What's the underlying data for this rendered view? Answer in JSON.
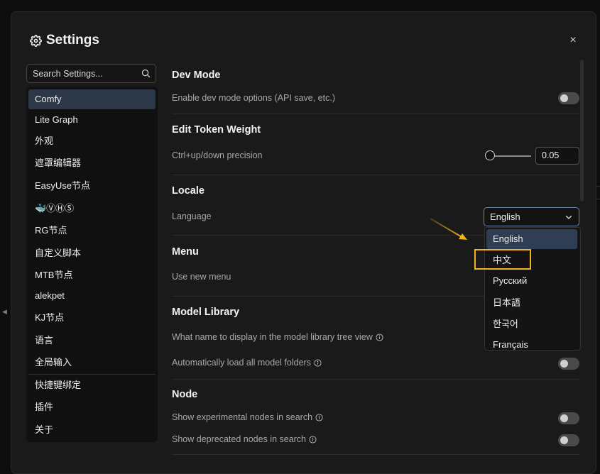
{
  "dialog": {
    "title": "Settings",
    "close_label": "×"
  },
  "search": {
    "placeholder": "Search Settings..."
  },
  "sidebar": {
    "items": [
      {
        "label": "Comfy",
        "active": true
      },
      {
        "label": "Lite Graph"
      },
      {
        "label": "外观"
      },
      {
        "label": "遮罩编辑器"
      },
      {
        "label": "EasyUse节点"
      },
      {
        "label": "🐳ⓋⒽⓈ"
      },
      {
        "label": "RG节点"
      },
      {
        "label": "自定义脚本"
      },
      {
        "label": "MTB节点"
      },
      {
        "label": "alekpet"
      },
      {
        "label": "KJ节点"
      },
      {
        "label": "语言"
      },
      {
        "label": "全局输入"
      },
      {
        "label": "快捷键绑定"
      },
      {
        "label": "插件"
      },
      {
        "label": "关于"
      }
    ]
  },
  "sections": {
    "dev_mode": {
      "title": "Dev Mode",
      "enable_label": "Enable dev mode options (API save, etc.)"
    },
    "edit_token_weight": {
      "title": "Edit Token Weight",
      "precision_label": "Ctrl+up/down precision",
      "precision_value": "0.05"
    },
    "locale": {
      "title": "Locale",
      "language_label": "Language",
      "language_value": "English",
      "options": [
        "English",
        "中文",
        "Русский",
        "日本語",
        "한국어",
        "Français"
      ]
    },
    "menu": {
      "title": "Menu",
      "new_menu_label": "Use new menu"
    },
    "model_library": {
      "title": "Model Library",
      "name_display_label": "What name to display in the model library tree view",
      "auto_load_label": "Automatically load all model folders"
    },
    "node": {
      "title": "Node",
      "experimental_label": "Show experimental nodes in search",
      "deprecated_label": "Show deprecated nodes in search"
    }
  },
  "colors": {
    "accent": "#f3b21b",
    "active_bg": "#2c3848",
    "select_border": "#6a86a8"
  }
}
